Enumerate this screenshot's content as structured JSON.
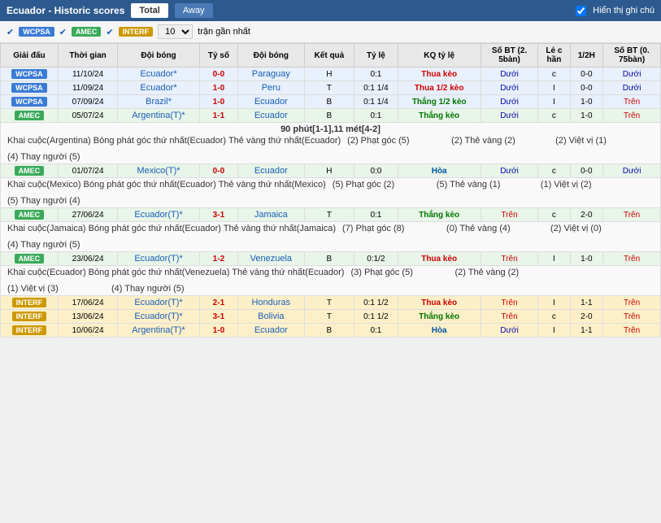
{
  "header": {
    "title": "Ecuador - Historic scores",
    "tabs": [
      "Total",
      "Away"
    ],
    "active_tab": "Total",
    "legend_label": "Hiển thị ghi chú"
  },
  "filters": {
    "wcpsa_label": "WCPSA",
    "amec_label": "AMEC",
    "interf_label": "INTERF",
    "count_value": "10",
    "count_label": "trận gần nhất"
  },
  "columns": [
    "Giải đấu",
    "Thời gian",
    "Đội bóng",
    "Tỷ số",
    "Đội bóng",
    "Kết quả",
    "Tỷ lệ",
    "KQ tỷ lệ",
    "Số BT (2. 5bàn)",
    "Lẻ c hần",
    "1/2H",
    "Số BT (0. 75bàn)"
  ],
  "rows": [
    {
      "type": "WCPSA",
      "date": "11/10/24",
      "team1": "Ecuador*",
      "score": "0-0",
      "team2": "Paraguay",
      "result": "H",
      "odds": "0:1",
      "kq": "Thua kèo",
      "bt25": "Dưới",
      "le_chan": "c",
      "half": "0-0",
      "bt075": "Dưới",
      "has_detail": false
    },
    {
      "type": "WCPSA",
      "date": "11/09/24",
      "team1": "Ecuador*",
      "score": "1-0",
      "team2": "Peru",
      "result": "T",
      "odds": "0:1 1/4",
      "kq": "Thua 1/2 kèo",
      "bt25": "Dưới",
      "le_chan": "I",
      "half": "0-0",
      "bt075": "Dưới",
      "has_detail": false
    },
    {
      "type": "WCPSA",
      "date": "07/09/24",
      "team1": "Brazil*",
      "score": "1-0",
      "team2": "Ecuador",
      "result": "B",
      "odds": "0:1 1/4",
      "kq": "Thắng 1/2 kèo",
      "bt25": "Dưới",
      "le_chan": "I",
      "half": "1-0",
      "bt075": "Trên",
      "has_detail": false
    },
    {
      "type": "AMEC",
      "date": "05/07/24",
      "team1": "Argentina(T)*",
      "score": "1-1",
      "team2": "Ecuador",
      "result": "B",
      "odds": "0:1",
      "kq": "Thắng kèo",
      "bt25": "Dưới",
      "le_chan": "c",
      "half": "1-0",
      "bt075": "Trên",
      "has_detail": true,
      "detail": {
        "note": "90 phút[1-1],11 mét[4-2]",
        "events": [
          "Khai cuộc(Argentina)   Bóng phát góc thứ nhất(Ecuador)   Thẻ vàng thứ nhất(Ecuador)",
          "(2) Phạt góc (5)",
          "(2) Thẻ vàng (2)",
          "(2) Việt vị (1)",
          "(4) Thay người (5)"
        ]
      }
    },
    {
      "type": "AMEC",
      "date": "01/07/24",
      "team1": "Mexico(T)*",
      "score": "0-0",
      "team2": "Ecuador",
      "result": "H",
      "odds": "0:0",
      "kq": "Hòa",
      "bt25": "Dưới",
      "le_chan": "c",
      "half": "0-0",
      "bt075": "Dưới",
      "has_detail": true,
      "detail": {
        "note": "",
        "events": [
          "Khai cuộc(Mexico)   Bóng phát góc thứ nhất(Ecuador)   Thẻ vàng thứ nhất(Mexico)",
          "(5) Phạt góc (2)",
          "(5) Thẻ vàng (1)",
          "(1) Việt vị (2)",
          "(5) Thay người (4)"
        ]
      }
    },
    {
      "type": "AMEC",
      "date": "27/06/24",
      "team1": "Ecuador(T)*",
      "score": "3-1",
      "team2": "Jamaica",
      "result": "T",
      "odds": "0:1",
      "kq": "Thắng kèo",
      "bt25": "Trên",
      "le_chan": "c",
      "half": "2-0",
      "bt075": "Trên",
      "has_detail": true,
      "detail": {
        "note": "",
        "events": [
          "Khai cuộc(Jamaica)   Bóng phát góc thứ nhất(Ecuador)   Thẻ vàng thứ nhất(Jamaica)",
          "(7) Phạt góc (8)",
          "(0) Thẻ vàng (4)",
          "(2) Việt vị (0)",
          "(4) Thay người (5)"
        ]
      }
    },
    {
      "type": "AMEC",
      "date": "23/06/24",
      "team1": "Ecuador(T)*",
      "score": "1-2",
      "team2": "Venezuela",
      "result": "B",
      "odds": "0:1/2",
      "kq": "Thua kèo",
      "bt25": "Trên",
      "le_chan": "I",
      "half": "1-0",
      "bt075": "Trên",
      "has_detail": true,
      "detail": {
        "note": "",
        "events": [
          "Khai cuộc(Ecuador)   Bóng phát góc thứ nhất(Venezuela)   Thẻ vàng thứ nhất(Ecuador)",
          "(3) Phạt góc (5)",
          "(2) Thẻ vàng (2)",
          "(1) Việt vị (3)",
          "(4) Thay người (5)"
        ]
      }
    },
    {
      "type": "INTERF",
      "date": "17/06/24",
      "team1": "Ecuador(T)*",
      "score": "2-1",
      "team2": "Honduras",
      "result": "T",
      "odds": "0:1 1/2",
      "kq": "Thua kèo",
      "bt25": "Trên",
      "le_chan": "I",
      "half": "1-1",
      "bt075": "Trên",
      "has_detail": false
    },
    {
      "type": "INTERF",
      "date": "13/06/24",
      "team1": "Ecuador(T)*",
      "score": "3-1",
      "team2": "Bolivia",
      "result": "T",
      "odds": "0:1 1/2",
      "kq": "Thắng kèo",
      "bt25": "Trên",
      "le_chan": "c",
      "half": "2-0",
      "bt075": "Trên",
      "has_detail": false
    },
    {
      "type": "INTERF",
      "date": "10/06/24",
      "team1": "Argentina(T)*",
      "score": "1-0",
      "team2": "Ecuador",
      "result": "B",
      "odds": "0:1",
      "kq": "Hòa",
      "bt25": "Dưới",
      "le_chan": "I",
      "half": "1-1",
      "bt075": "Trên",
      "has_detail": false
    }
  ]
}
